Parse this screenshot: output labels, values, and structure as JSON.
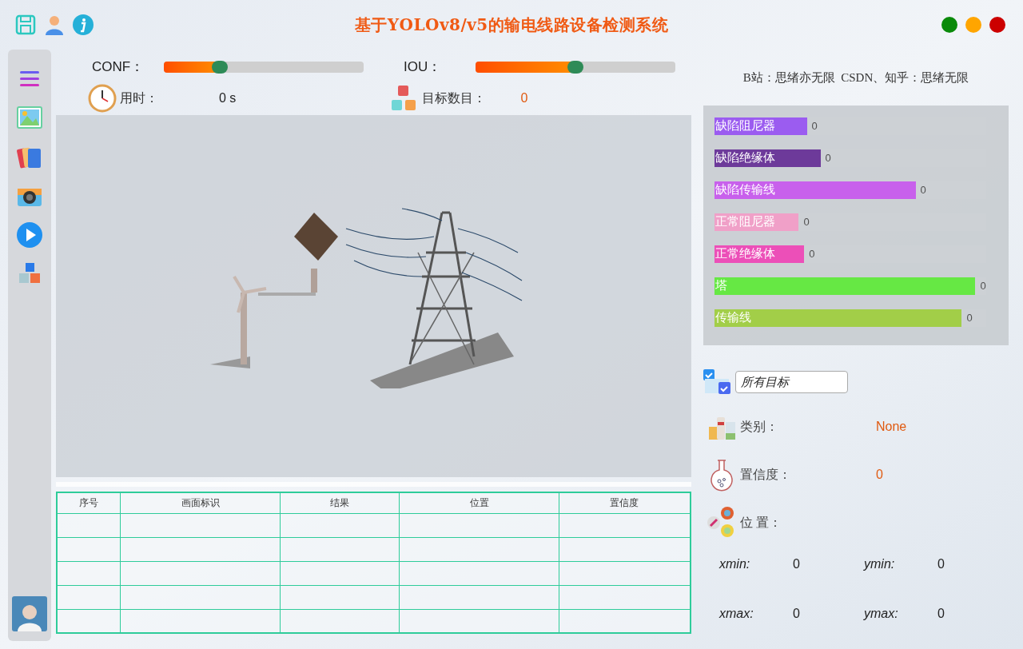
{
  "window": {
    "title": "基于YOLOv8/v5的输电线路设备检测系统"
  },
  "sliders": [
    {
      "label": "CONF：",
      "level": 0.28
    },
    {
      "label": "IOU：",
      "level": 0.5
    }
  ],
  "stats": [
    {
      "kind": "time",
      "label": "用时：",
      "value": "0 s"
    },
    {
      "kind": "count",
      "label": "目标数目：",
      "value": "0"
    }
  ],
  "credit": "B站：思绪亦无限  CSDN、知乎：思绪无限",
  "classes": [
    {
      "name": "缺陷阻尼器",
      "count": "0",
      "level": 0.34,
      "color": "#9b5cf0"
    },
    {
      "name": "缺陷绝缘体",
      "count": "0",
      "level": 0.39,
      "color": "#6d3a9a"
    },
    {
      "name": "缺陷传输线",
      "count": "0",
      "level": 0.74,
      "color": "#c860ec"
    },
    {
      "name": "正常阻尼器",
      "count": "0",
      "level": 0.31,
      "color": "#f0a0c8"
    },
    {
      "name": "正常绝缘体",
      "count": "0",
      "level": 0.33,
      "color": "#ec4fb8"
    },
    {
      "name": "塔",
      "count": "0",
      "level": 0.96,
      "color": "#66e844"
    },
    {
      "name": "传输线",
      "count": "0",
      "level": 0.91,
      "color": "#a2ce48"
    }
  ],
  "filter": {
    "value": "所有目标"
  },
  "details": [
    {
      "kind": "class",
      "label": "类别：",
      "value": "None"
    },
    {
      "kind": "confidence",
      "label": "置信度：",
      "value": "0"
    },
    {
      "kind": "position",
      "label": "位 置："
    }
  ],
  "coords": [
    {
      "label": "xmin:",
      "value": "0"
    },
    {
      "label": "ymin:",
      "value": "0"
    },
    {
      "label": "xmax:",
      "value": "0"
    },
    {
      "label": "ymax:",
      "value": "0"
    }
  ],
  "table": {
    "columns": [
      "序号",
      "画面标识",
      "结果",
      "位置",
      "置信度"
    ]
  }
}
